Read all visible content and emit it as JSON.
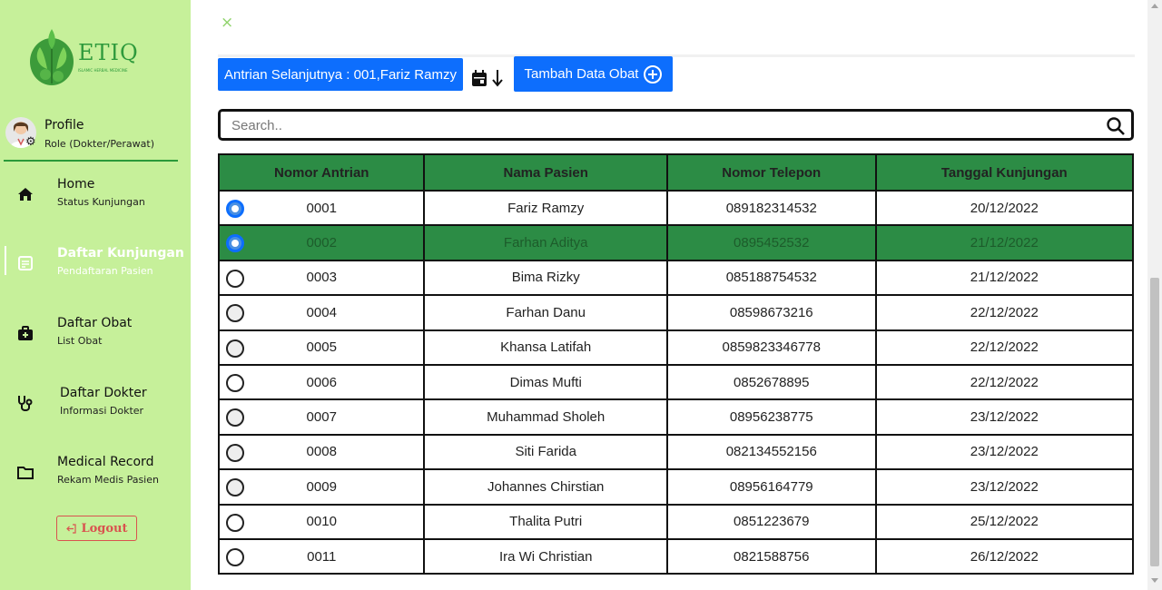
{
  "brand": {
    "name": "ETIQ",
    "tagline": "ISLAMIC HERBAL MEDICINE"
  },
  "profile": {
    "name": "Profile",
    "role": "Role (Dokter/Perawat)"
  },
  "nav": [
    {
      "title": "Home",
      "sub": "Status Kunjungan",
      "icon": "home-icon"
    },
    {
      "title": "Daftar Kunjungan",
      "sub": "Pendaftaran Pasien",
      "icon": "document-icon"
    },
    {
      "title": "Daftar Obat",
      "sub": "List Obat",
      "icon": "medkit-icon"
    },
    {
      "title": "Daftar Dokter",
      "sub": "Informasi Dokter",
      "icon": "stethoscope-icon"
    },
    {
      "title": "Medical Record",
      "sub": "Rekam Medis Pasien",
      "icon": "folder-icon"
    }
  ],
  "logout_label": "Logout",
  "close_label": "×",
  "toolbar": {
    "next_queue_label": "Antrian Selanjutnya : 001,Fariz Ramzy",
    "add_medicine_label": "Tambah Data Obat"
  },
  "search": {
    "placeholder": "Search..",
    "value": ""
  },
  "table": {
    "headers": [
      "Nomor Antrian",
      "Nama Pasien",
      "Nomor Telepon",
      "Tanggal Kunjungan"
    ],
    "rows": [
      {
        "no": "0001",
        "name": "Fariz Ramzy",
        "phone": "089182314532",
        "date": "20/12/2022",
        "radio": "on"
      },
      {
        "no": "0002",
        "name": "Farhan Aditya",
        "phone": "0895452532",
        "date": "21/12/2022",
        "radio": "on"
      },
      {
        "no": "0003",
        "name": "Bima Rizky",
        "phone": "085188754532",
        "date": "21/12/2022",
        "radio": "off"
      },
      {
        "no": "0004",
        "name": "Farhan Danu",
        "phone": "08598673216",
        "date": "22/12/2022",
        "radio": "off"
      },
      {
        "no": "0005",
        "name": "Khansa Latifah",
        "phone": "0859823346778",
        "date": "22/12/2022",
        "radio": "off"
      },
      {
        "no": "0006",
        "name": "Dimas Mufti",
        "phone": "0852678895",
        "date": "22/12/2022",
        "radio": "off"
      },
      {
        "no": "0007",
        "name": "Muhammad Sholeh",
        "phone": "08956238775",
        "date": "23/12/2022",
        "radio": "off"
      },
      {
        "no": "0008",
        "name": "Siti Farida",
        "phone": "082134552156",
        "date": "23/12/2022",
        "radio": "off"
      },
      {
        "no": "0009",
        "name": "Johannes Chirstian",
        "phone": "08956164779",
        "date": "23/12/2022",
        "radio": "off"
      },
      {
        "no": "0010",
        "name": "Thalita Putri",
        "phone": "0851223679",
        "date": "25/12/2022",
        "radio": "off"
      },
      {
        "no": "0011",
        "name": "Ira Wi Christian",
        "phone": "0821588756",
        "date": "26/12/2022",
        "radio": "off"
      }
    ]
  },
  "colors": {
    "sidebar": "#c6f09a",
    "accent_green": "#2c8c45",
    "button_blue": "#0d6efd",
    "logout_red": "#d9534f"
  }
}
